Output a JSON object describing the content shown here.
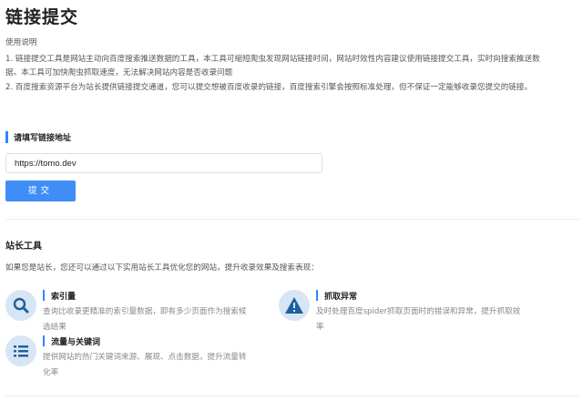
{
  "page": {
    "title": "链接提交"
  },
  "usage": {
    "title": "使用说明",
    "line1": "1. 链接提交工具是网站主动向百度搜索推送数据的工具，本工具可缩短爬虫发现网站链接时间，网站时效性内容建议使用链接提交工具，实时向搜索推送数",
    "line2": "据。本工具可加快爬虫抓取速度，无法解决网站内容是否收录问题",
    "line3": "2. 百度搜索资源平台为站长提供链接提交通道，您可以提交想被百度收录的链接，百度搜索引擎会按照标准处理，但不保证一定能够收录您提交的链接。"
  },
  "form": {
    "section_label": "请填写链接地址",
    "url_value": "https://tomo.dev",
    "submit_label": "提交"
  },
  "tools": {
    "title": "站长工具",
    "description": "如果您是站长，您还可以通过以下实用站长工具优化您的网站，提升收录效果及搜索表现：",
    "items": [
      {
        "name": "索引量",
        "desc_line1": "查询比收录更精准的索引量数据，即有多少页面作为搜索候",
        "desc_line2": "选结果",
        "icon": "search-icon"
      },
      {
        "name": "抓取异常",
        "desc_line1": "及时处理百度spider抓取页面时的错误和异常，提升抓取效",
        "desc_line2": "率",
        "icon": "warning-icon"
      },
      {
        "name": "流量与关键词",
        "desc_line1": "提供网站的热门关键词来源、展现、点击数据，提升流量转",
        "desc_line2": "化率",
        "icon": "list-icon"
      }
    ]
  },
  "colors": {
    "accent": "#3385ff",
    "button": "#3f8ef7",
    "icon_bg": "#d7e6f4",
    "icon_fg": "#1f5f9e"
  }
}
